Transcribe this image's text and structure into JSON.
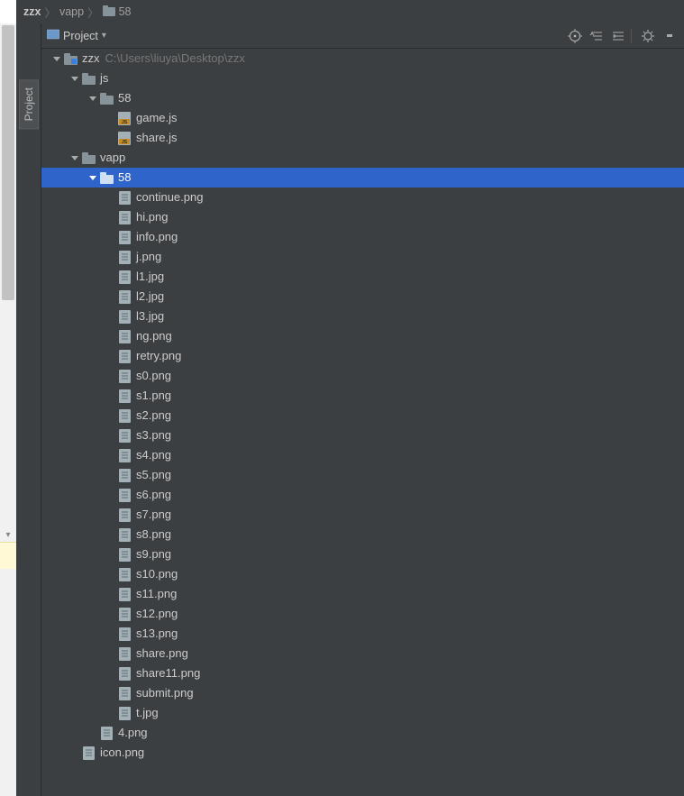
{
  "breadcrumb": {
    "items": [
      "zzx",
      "vapp",
      "58"
    ]
  },
  "sideTabs": {
    "project": "Project"
  },
  "panel": {
    "title": "Project"
  },
  "tree": {
    "rows": [
      {
        "id": "root",
        "indent": 0,
        "chev": "down",
        "icon": "proj",
        "label": "zzx",
        "extra": "C:\\Users\\liuya\\Desktop\\zzx",
        "selected": false
      },
      {
        "id": "js",
        "indent": 1,
        "chev": "down",
        "icon": "folder",
        "label": "js",
        "selected": false
      },
      {
        "id": "js58",
        "indent": 2,
        "chev": "down",
        "icon": "folder",
        "label": "58",
        "selected": false
      },
      {
        "id": "gamejs",
        "indent": 3,
        "chev": "none",
        "icon": "js",
        "label": "game.js",
        "selected": false
      },
      {
        "id": "sharejs",
        "indent": 3,
        "chev": "none",
        "icon": "js",
        "label": "share.js",
        "selected": false
      },
      {
        "id": "vapp",
        "indent": 1,
        "chev": "down",
        "icon": "folder",
        "label": "vapp",
        "selected": false
      },
      {
        "id": "vapp58",
        "indent": 2,
        "chev": "down",
        "icon": "folder",
        "label": "58",
        "selected": true
      },
      {
        "id": "continue",
        "indent": 3,
        "chev": "none",
        "icon": "file",
        "label": "continue.png",
        "selected": false
      },
      {
        "id": "hi",
        "indent": 3,
        "chev": "none",
        "icon": "file",
        "label": "hi.png",
        "selected": false
      },
      {
        "id": "info",
        "indent": 3,
        "chev": "none",
        "icon": "file",
        "label": "info.png",
        "selected": false
      },
      {
        "id": "jp",
        "indent": 3,
        "chev": "none",
        "icon": "file",
        "label": "j.png",
        "selected": false
      },
      {
        "id": "l1",
        "indent": 3,
        "chev": "none",
        "icon": "file",
        "label": "l1.jpg",
        "selected": false
      },
      {
        "id": "l2",
        "indent": 3,
        "chev": "none",
        "icon": "file",
        "label": "l2.jpg",
        "selected": false
      },
      {
        "id": "l3",
        "indent": 3,
        "chev": "none",
        "icon": "file",
        "label": "l3.jpg",
        "selected": false
      },
      {
        "id": "ng",
        "indent": 3,
        "chev": "none",
        "icon": "file",
        "label": "ng.png",
        "selected": false
      },
      {
        "id": "retry",
        "indent": 3,
        "chev": "none",
        "icon": "file",
        "label": "retry.png",
        "selected": false
      },
      {
        "id": "s0",
        "indent": 3,
        "chev": "none",
        "icon": "file",
        "label": "s0.png",
        "selected": false
      },
      {
        "id": "s1",
        "indent": 3,
        "chev": "none",
        "icon": "file",
        "label": "s1.png",
        "selected": false
      },
      {
        "id": "s2",
        "indent": 3,
        "chev": "none",
        "icon": "file",
        "label": "s2.png",
        "selected": false
      },
      {
        "id": "s3",
        "indent": 3,
        "chev": "none",
        "icon": "file",
        "label": "s3.png",
        "selected": false
      },
      {
        "id": "s4",
        "indent": 3,
        "chev": "none",
        "icon": "file",
        "label": "s4.png",
        "selected": false
      },
      {
        "id": "s5",
        "indent": 3,
        "chev": "none",
        "icon": "file",
        "label": "s5.png",
        "selected": false
      },
      {
        "id": "s6",
        "indent": 3,
        "chev": "none",
        "icon": "file",
        "label": "s6.png",
        "selected": false
      },
      {
        "id": "s7",
        "indent": 3,
        "chev": "none",
        "icon": "file",
        "label": "s7.png",
        "selected": false
      },
      {
        "id": "s8",
        "indent": 3,
        "chev": "none",
        "icon": "file",
        "label": "s8.png",
        "selected": false
      },
      {
        "id": "s9",
        "indent": 3,
        "chev": "none",
        "icon": "file",
        "label": "s9.png",
        "selected": false
      },
      {
        "id": "s10",
        "indent": 3,
        "chev": "none",
        "icon": "file",
        "label": "s10.png",
        "selected": false
      },
      {
        "id": "s11p",
        "indent": 3,
        "chev": "none",
        "icon": "file",
        "label": "s11.png",
        "selected": false
      },
      {
        "id": "s12",
        "indent": 3,
        "chev": "none",
        "icon": "file",
        "label": "s12.png",
        "selected": false
      },
      {
        "id": "s13",
        "indent": 3,
        "chev": "none",
        "icon": "file",
        "label": "s13.png",
        "selected": false
      },
      {
        "id": "sharep",
        "indent": 3,
        "chev": "none",
        "icon": "file",
        "label": "share.png",
        "selected": false
      },
      {
        "id": "share11",
        "indent": 3,
        "chev": "none",
        "icon": "file",
        "label": "share11.png",
        "selected": false
      },
      {
        "id": "submit",
        "indent": 3,
        "chev": "none",
        "icon": "file",
        "label": "submit.png",
        "selected": false
      },
      {
        "id": "t",
        "indent": 3,
        "chev": "none",
        "icon": "file",
        "label": "t.jpg",
        "selected": false
      },
      {
        "id": "4png",
        "indent": 2,
        "chev": "none",
        "icon": "file",
        "label": "4.png",
        "selected": false
      },
      {
        "id": "iconp",
        "indent": 1,
        "chev": "none",
        "icon": "file",
        "label": "icon.png",
        "selected": false
      }
    ]
  }
}
